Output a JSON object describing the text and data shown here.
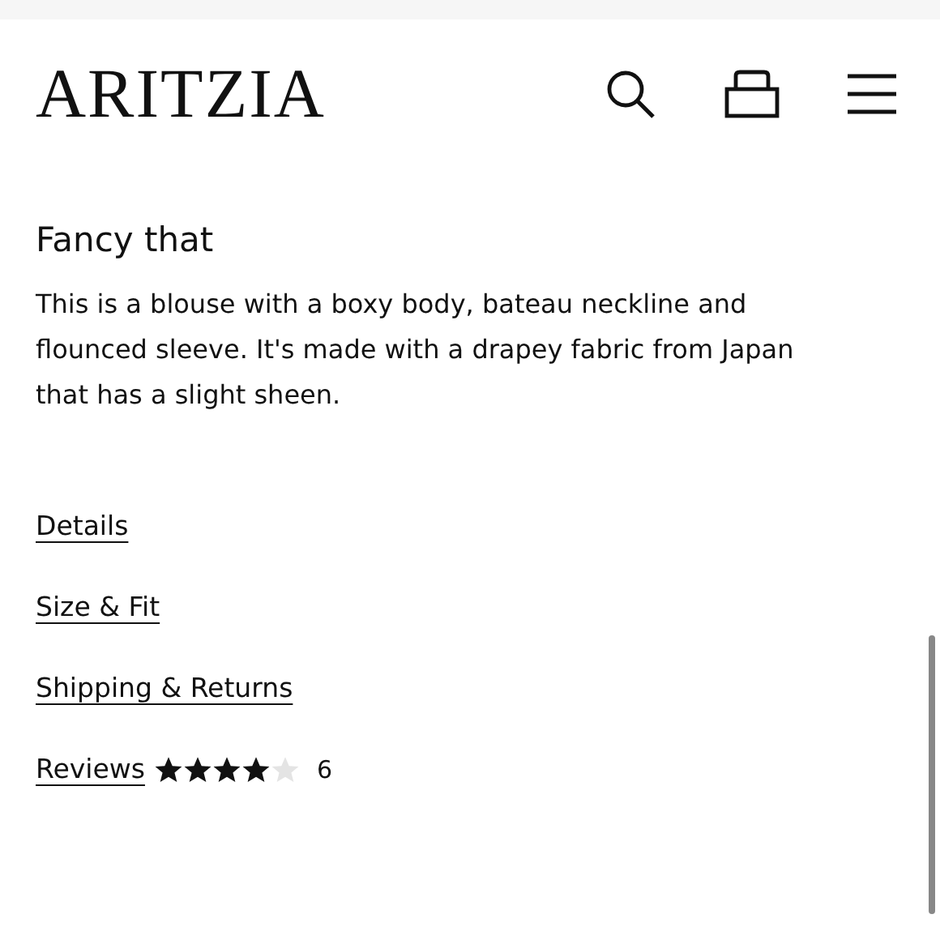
{
  "header": {
    "logo": "ARITZIA"
  },
  "product": {
    "heading": "Fancy that",
    "description": "This is a blouse with a boxy body, bateau neckline and flounced sleeve. It's made with a drapey fabric from Japan that has a slight sheen."
  },
  "links": [
    {
      "kind": "link",
      "label": "Details"
    },
    {
      "kind": "link",
      "label": "Size & Fit"
    },
    {
      "kind": "link",
      "label": "Shipping & Returns"
    },
    {
      "kind": "reviews",
      "label": "Reviews",
      "stars": 4,
      "count": "6"
    }
  ]
}
